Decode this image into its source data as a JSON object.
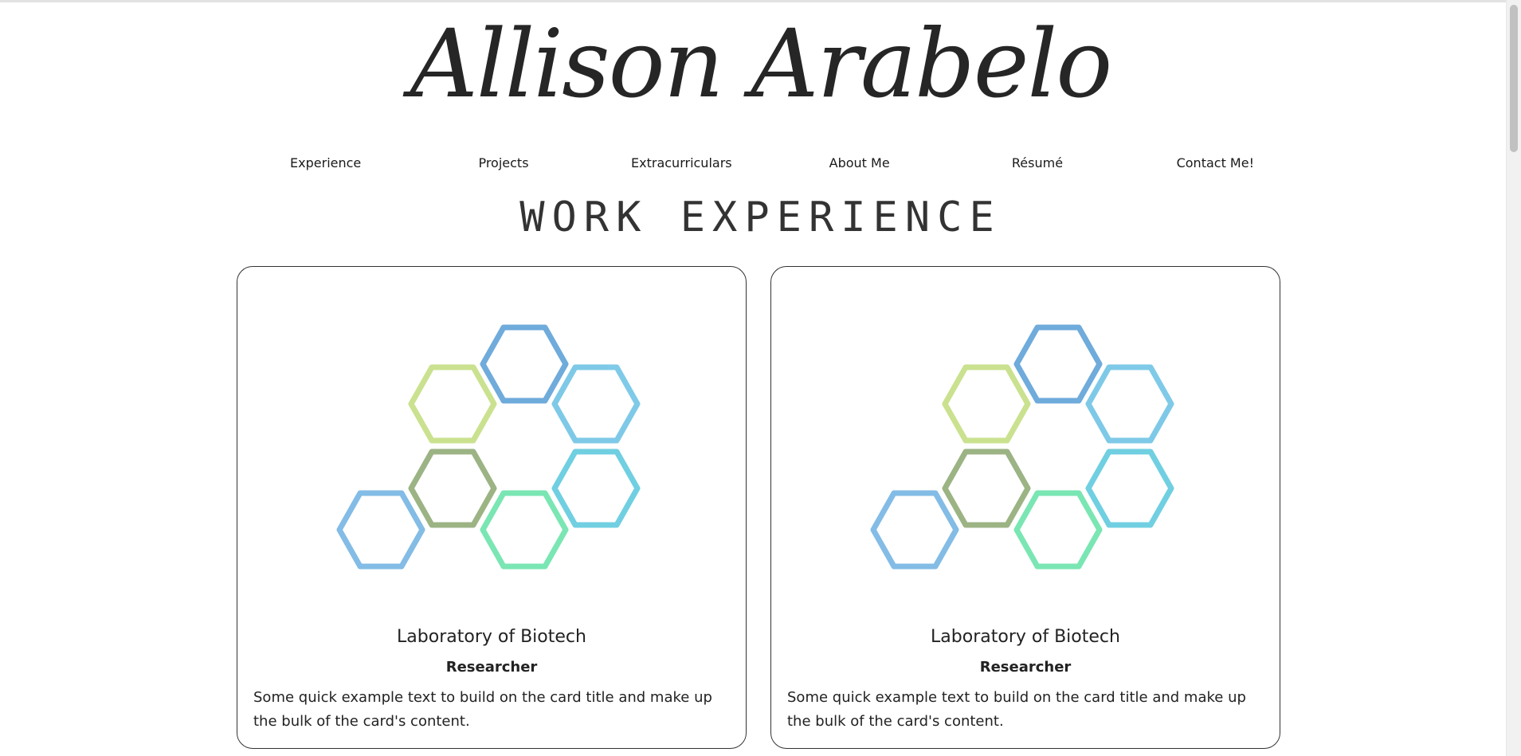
{
  "site": {
    "title": "Allison Arabelo"
  },
  "nav": {
    "items": [
      {
        "label": "Experience"
      },
      {
        "label": "Projects"
      },
      {
        "label": "Extracurriculars"
      },
      {
        "label": "About Me"
      },
      {
        "label": "Résumé"
      },
      {
        "label": "Contact Me!"
      }
    ]
  },
  "section": {
    "heading": "WORK EXPERIENCE"
  },
  "cards": [
    {
      "image_icon": "hexagon-molecule-icon",
      "title": "Laboratory of Biotech",
      "subtitle": "Researcher",
      "text": "Some quick example text to build on the card title and make up the bulk of the card's content."
    },
    {
      "image_icon": "hexagon-molecule-icon",
      "title": "Laboratory of Biotech",
      "subtitle": "Researcher",
      "text": "Some quick example text to build on the card title and make up the bulk of the card's content."
    }
  ],
  "colors": {
    "hex_lime": "#b9d86a",
    "hex_blue": "#3f8fd0",
    "hex_sky": "#54b8e0",
    "hex_olive": "#7c9a5c",
    "hex_teal": "#41bfd8",
    "hex_mint": "#4ede9a",
    "hex_light_blue": "#5aa6dd",
    "card_border": "#333333"
  }
}
